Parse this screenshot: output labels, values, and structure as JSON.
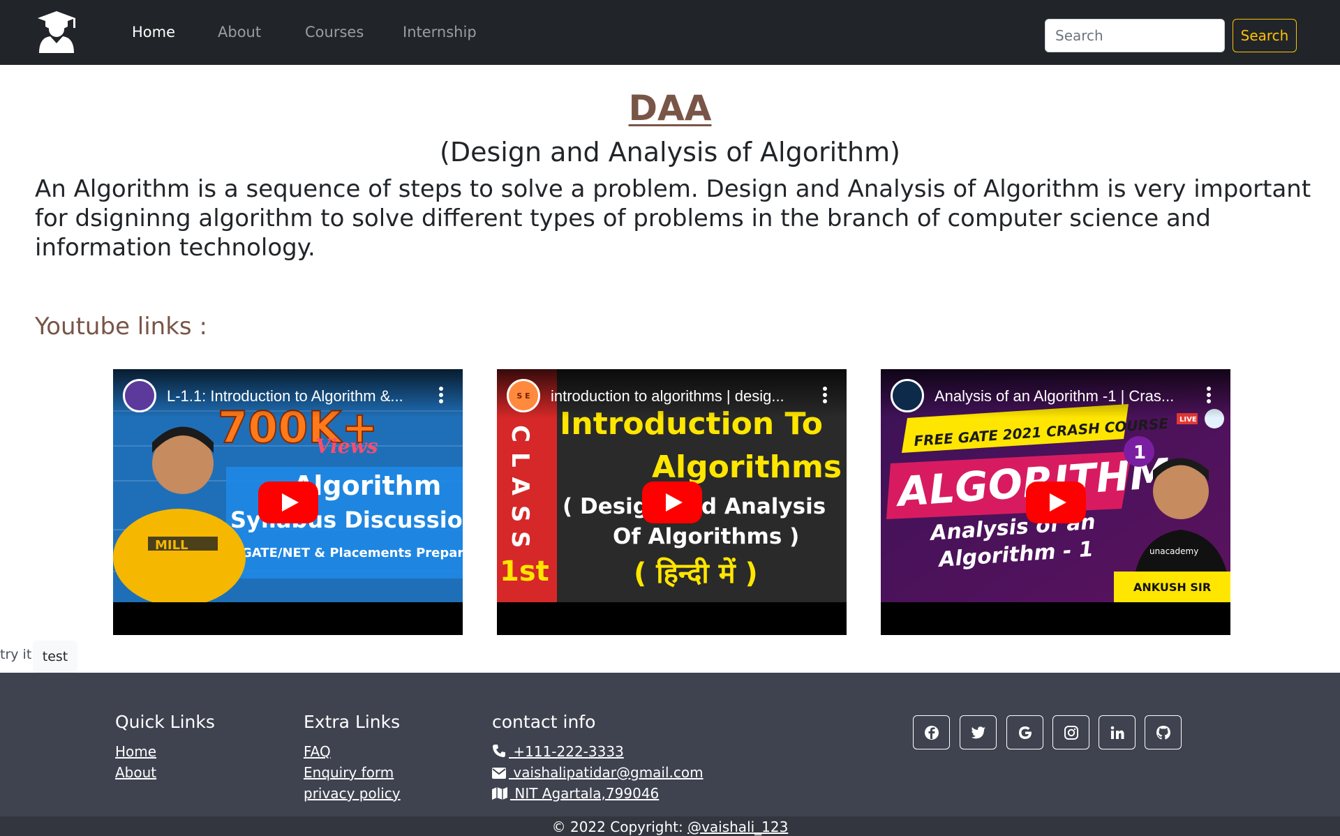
{
  "nav": {
    "links": [
      "Home",
      "About",
      "Courses",
      "Internship"
    ],
    "search_placeholder": "Search",
    "search_button": "Search"
  },
  "main": {
    "title": "DAA",
    "subtitle": "(Design and Analysis of Algorithm)",
    "description": "An Algorithm is a sequence of steps to solve a problem. Design and Analysis of Algorithm is very important for dsigninng algorithm to solve different types of problems in the branch of computer science and information technology.",
    "youtube_heading": "Youtube links :",
    "videos": [
      {
        "title": "L-1.1: Introduction to Algorithm &...",
        "thumb_lines": [
          "700K+",
          "Views",
          "Algorithm",
          "Syllabus Discussion",
          "GATE/NET & Placements Preparation"
        ],
        "shirt_text": "MILL"
      },
      {
        "title": "introduction to algorithms | desig...",
        "thumb_lines": [
          "Introduction To",
          "Algorithms",
          "( Design and  Analysis",
          "Of Algorithms )",
          "( हिन्दी में )",
          "CLASS",
          "1st"
        ],
        "channel_initials": "S E"
      },
      {
        "title": "Analysis of an Algorithm -1 | Cras...",
        "thumb_lines": [
          "FREE GATE 2021 CRASH COURSE",
          "ALGORITHM",
          "Analysis of an",
          "Algorithm - 1",
          "ANKUSH SIR",
          "1",
          "LIVE",
          "unacademy"
        ]
      }
    ],
    "try_it": "try it",
    "test_button": "test"
  },
  "footer": {
    "quick_links_heading": "Quick Links",
    "quick_links": [
      "Home",
      "About"
    ],
    "extra_links_heading": "Extra Links",
    "extra_links": [
      "FAQ",
      "Enquiry form",
      "privacy policy"
    ],
    "contact_heading": "contact info",
    "phone": " +111-222-3333",
    "email": " vaishalipatidar@gmail.com",
    "address": " NIT Agartala,799046",
    "socials": [
      "facebook-icon",
      "twitter-icon",
      "google-icon",
      "instagram-icon",
      "linkedin-icon",
      "github-icon"
    ],
    "copyright_prefix": "© 2022 Copyright: ",
    "copyright_handle": "@vaishali_123"
  },
  "colors": {
    "navbar": "#212529",
    "accent_brown": "#795548",
    "warning": "#ffc107",
    "footer": "#3f4350"
  }
}
